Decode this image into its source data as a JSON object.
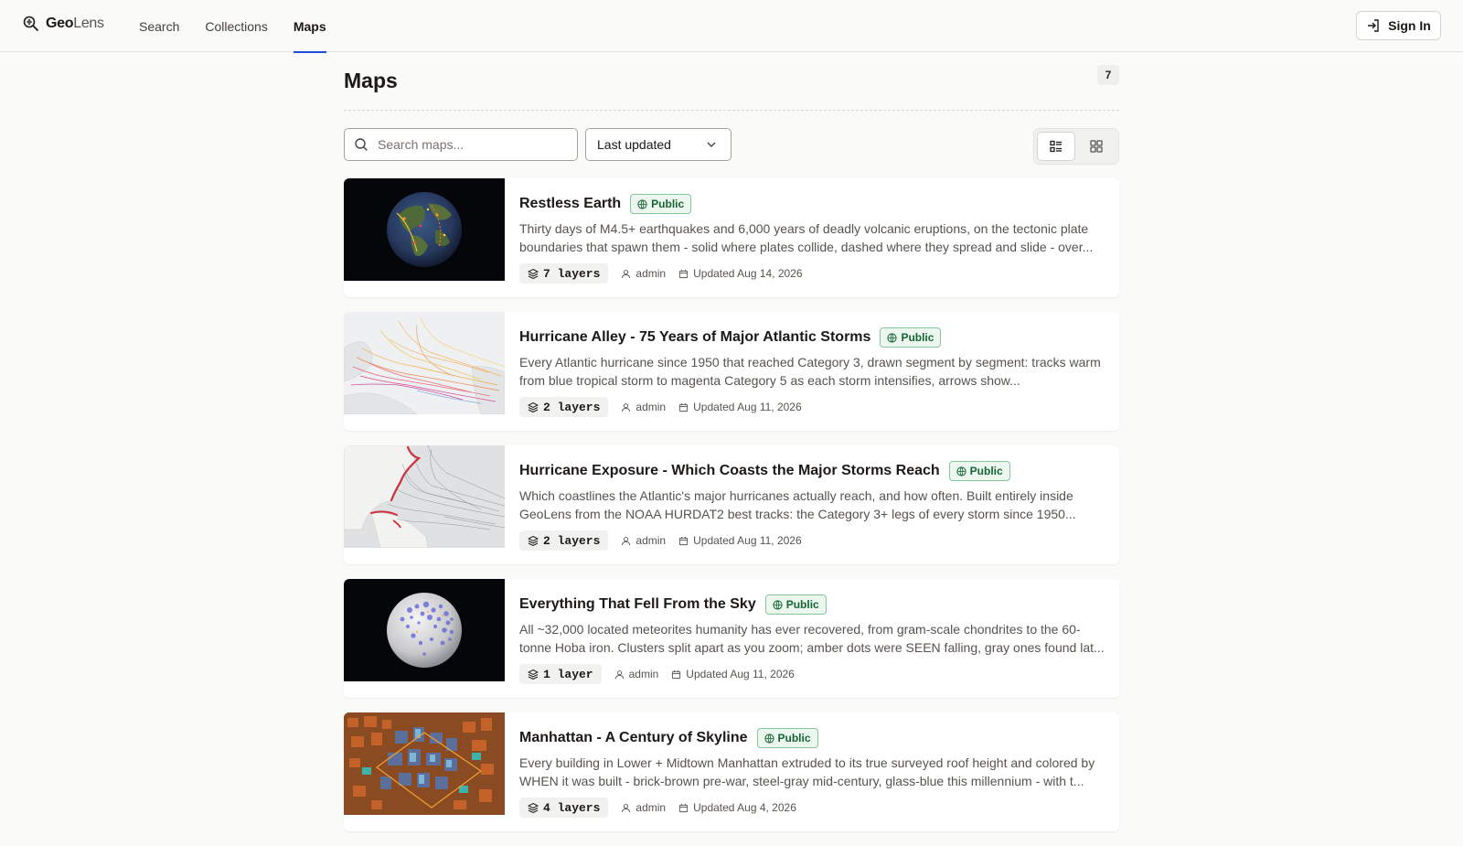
{
  "app": {
    "name_bold": "Geo",
    "name_light": "Lens"
  },
  "nav": {
    "items": [
      {
        "label": "Search",
        "active": false
      },
      {
        "label": "Collections",
        "active": false
      },
      {
        "label": "Maps",
        "active": true
      }
    ],
    "sign_in": "Sign In"
  },
  "page": {
    "title": "Maps",
    "count": "7",
    "search_placeholder": "Search maps...",
    "sort_value": "Last updated",
    "view_mode": "list"
  },
  "maps": [
    {
      "title": "Restless Earth",
      "visibility": "Public",
      "description": "Thirty days of M4.5+ earthquakes and 6,000 years of deadly volcanic eruptions, on the tectonic plate boundaries that spawn them - solid where plates collide, dashed where they spread and slide - over...",
      "layers": "7 layers",
      "owner": "admin",
      "updated": "Updated Aug 14, 2026",
      "thumbnail": "globe-dark"
    },
    {
      "title": "Hurricane Alley - 75 Years of Major Atlantic Storms",
      "visibility": "Public",
      "description": "Every Atlantic hurricane since 1950 that reached Category 3, drawn segment by segment: tracks warm from blue tropical storm to magenta Category 5 as each storm intensifies, arrows show...",
      "layers": "2 layers",
      "owner": "admin",
      "updated": "Updated Aug 11, 2026",
      "thumbnail": "hurricane-tracks"
    },
    {
      "title": "Hurricane Exposure - Which Coasts the Major Storms Reach",
      "visibility": "Public",
      "description": "Which coastlines the Atlantic's major hurricanes actually reach, and how often. Built entirely inside GeoLens from the NOAA HURDAT2 best tracks: the Category 3+ legs of every storm since 1950...",
      "layers": "2 layers",
      "owner": "admin",
      "updated": "Updated Aug 11, 2026",
      "thumbnail": "hurricane-exposure"
    },
    {
      "title": "Everything That Fell From the Sky",
      "visibility": "Public",
      "description": "All ~32,000 located meteorites humanity has ever recovered, from gram-scale chondrites to the 60-tonne Hoba iron. Clusters split apart as you zoom; amber dots were SEEN falling, gray ones found lat...",
      "layers": "1 layer",
      "owner": "admin",
      "updated": "Updated Aug 11, 2026",
      "thumbnail": "globe-meteorites"
    },
    {
      "title": "Manhattan - A Century of Skyline",
      "visibility": "Public",
      "description": "Every building in Lower + Midtown Manhattan extruded to its true surveyed roof height and colored by WHEN it was built - brick-brown pre-war, steel-gray mid-century, glass-blue this millennium - with t...",
      "layers": "4 layers",
      "owner": "admin",
      "updated": "Updated Aug 4, 2026",
      "thumbnail": "manhattan-3d"
    }
  ]
}
